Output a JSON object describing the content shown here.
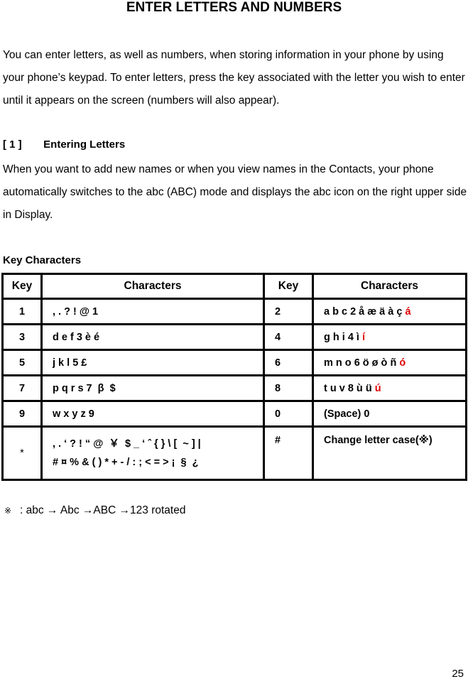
{
  "title": "ENTER LETTERS AND NUMBERS",
  "intro": "You can enter letters, as well as numbers, when storing information in your phone by using your phone’s keypad. To enter letters, press the key associated with the letter you wish to enter until it appears on the screen (numbers will also appear).",
  "section": {
    "number": "[ 1 ]",
    "heading": "Entering Letters",
    "body": "When you want to add new names or when you view names in the Contacts, your phone automatically switches to the abc (ABC) mode and displays the abc icon on the right upper side in Display."
  },
  "key_characters_heading": "Key Characters",
  "table": {
    "headers": [
      "Key",
      "Characters",
      "Key",
      "Characters"
    ],
    "rows": [
      {
        "key_left": "1",
        "chars_left": ", . ? ! @ 1",
        "key_right": "2",
        "chars_right": "a b c 2 å æ ä à ç",
        "chars_right_red": "á"
      },
      {
        "key_left": "3",
        "chars_left": "d e f 3 è é",
        "key_right": "4",
        "chars_right": "g h i 4 ì",
        "chars_right_red": "í"
      },
      {
        "key_left": "5",
        "chars_left": "j k l 5 £",
        "key_right": "6",
        "chars_right": "m n o 6 ö ø ò ñ",
        "chars_right_red": "ó"
      },
      {
        "key_left": "7",
        "chars_left": "p q r s 7  β  $",
        "key_right": "8",
        "chars_right": "t u v 8 ù ü",
        "chars_right_red": "ú"
      },
      {
        "key_left": "9",
        "chars_left": "w x y z 9",
        "key_right": "0",
        "chars_right": "(Space) 0",
        "chars_right_red": ""
      }
    ],
    "star_row": {
      "key_left": "*",
      "chars_line1": ", . ‘ ? ! “ @  ￥  $ _ ‘ ˆ { } \\ [  ~ ] |",
      "chars_line2": "# ¤ % & ( ) * + - / : ; < = > ¡  §  ¿",
      "key_right": "#",
      "chars_right": "Change letter case(※)"
    }
  },
  "note": {
    "mark": "※",
    "text": ": abc → Abc →ABC →123 rotated"
  },
  "page_number": "25",
  "colors": {
    "highlight_red": "#e00000"
  }
}
